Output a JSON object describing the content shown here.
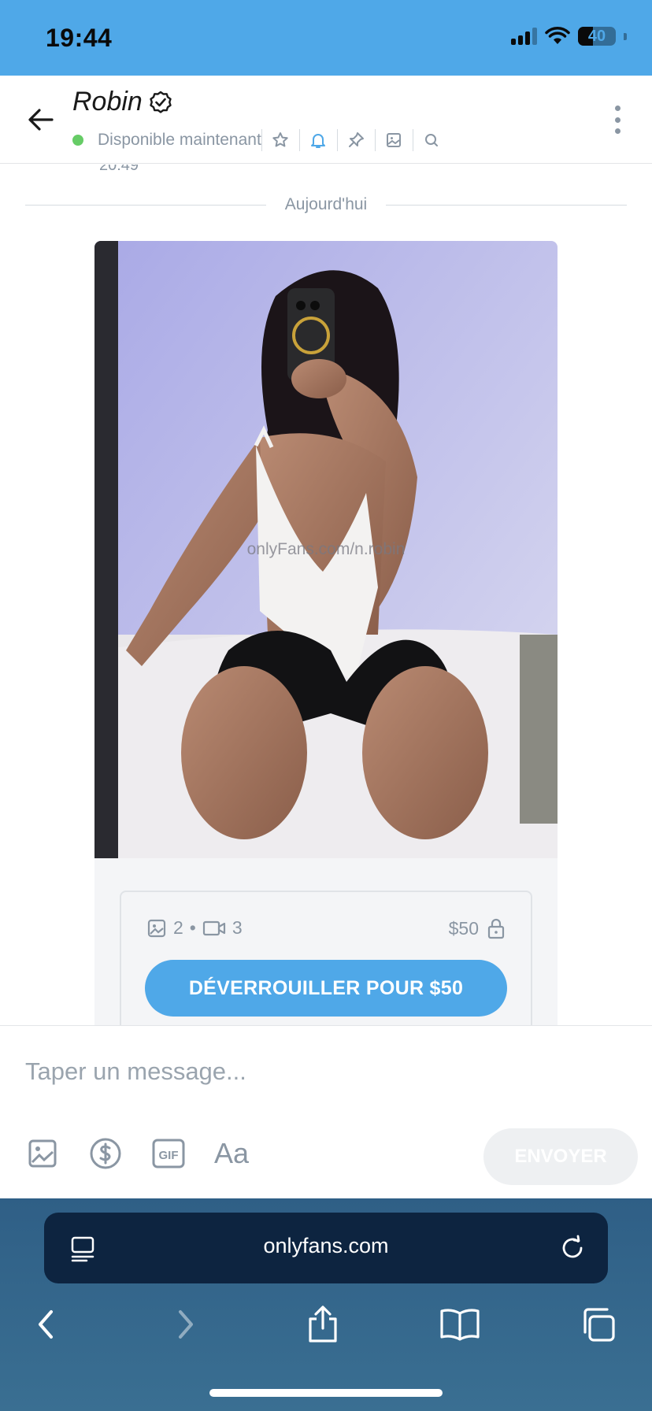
{
  "status_bar": {
    "time": "19:44",
    "battery": "40",
    "battery_level": 0.4
  },
  "header": {
    "contact_name": "Robin",
    "status": "Disponible maintenant",
    "icons": [
      "star-icon",
      "bell-icon",
      "pin-icon",
      "image-icon",
      "search-icon"
    ]
  },
  "chat": {
    "previous_time": "20:49",
    "date_divider": "Aujourd'hui",
    "watermark": "onlyFans.com/n.robin",
    "locked": {
      "image_count": "2",
      "separator": "•",
      "video_count": "3",
      "price": "$50",
      "unlock_label": "DÉVERROUILLER POUR $50"
    }
  },
  "composer": {
    "placeholder": "Taper un message...",
    "font_label": "Aa",
    "send_label": "ENVOYER",
    "tools": [
      "image-icon",
      "dollar-icon",
      "gif-icon",
      "text-format-icon"
    ]
  },
  "browser": {
    "url": "onlyfans.com"
  },
  "colors": {
    "accent": "#4fa8e8",
    "online": "#66cc66",
    "muted": "#8a96a3",
    "browser_bar": "#0d2440"
  }
}
